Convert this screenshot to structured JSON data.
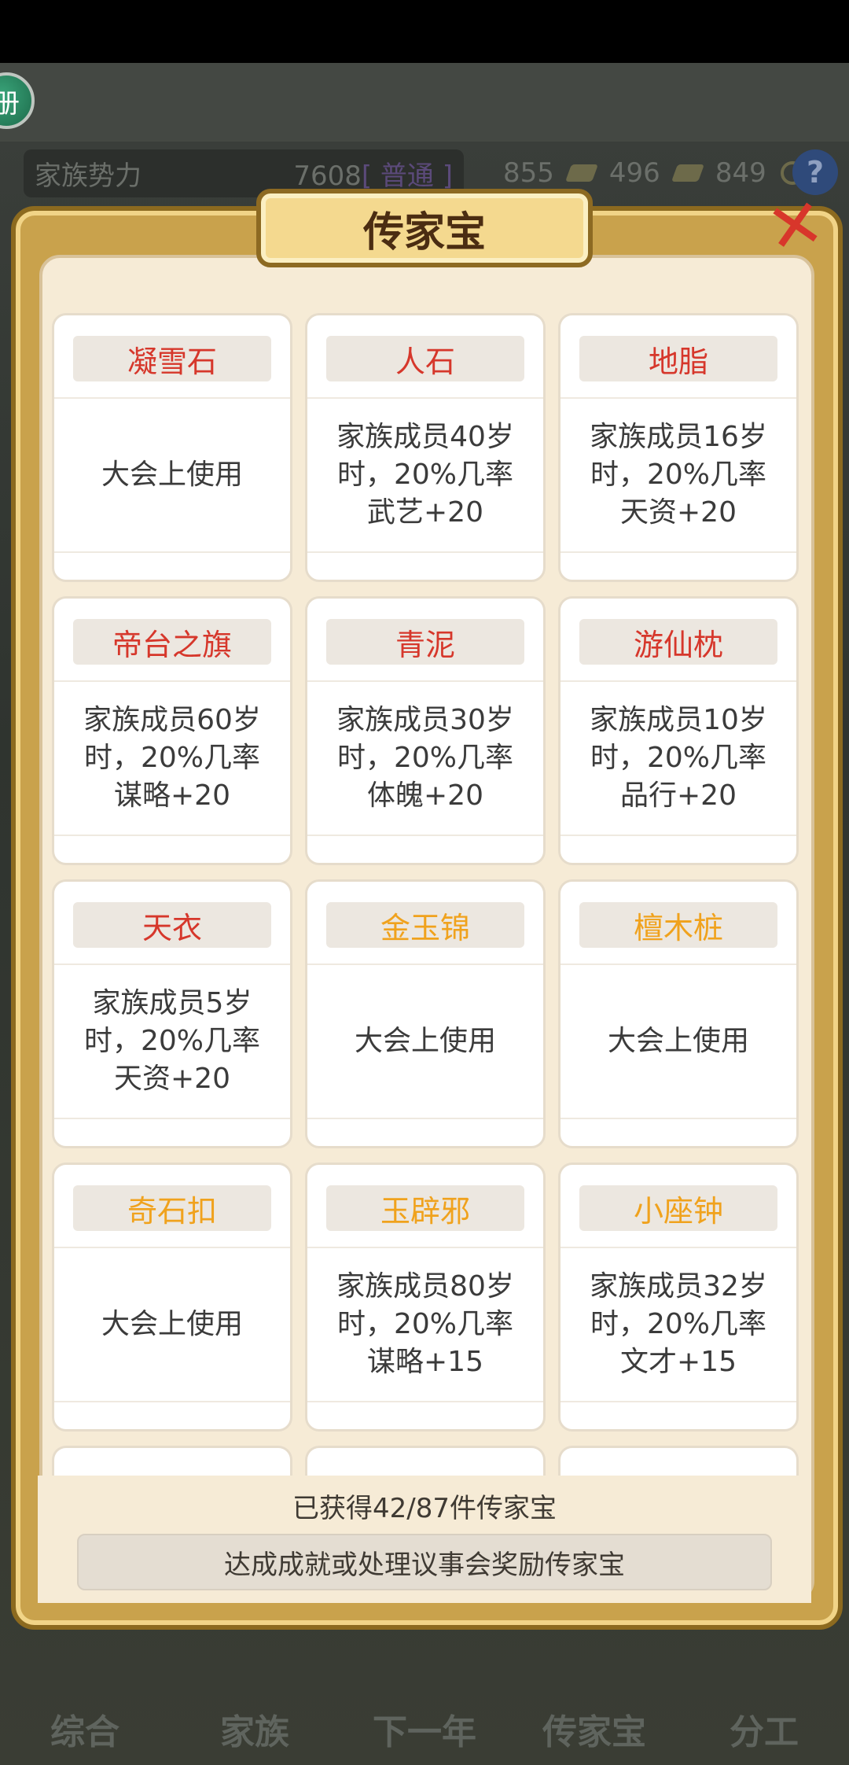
{
  "header": {
    "avatar_glyph": "册",
    "clan_label": "家族势力",
    "clan_value": "7608",
    "clan_rank": "[ 普通 ]",
    "silver": "855",
    "iron": "496",
    "coins": "849",
    "help_glyph": "?"
  },
  "modal": {
    "title": "传家宝",
    "close_glyph": "✕",
    "items": [
      {
        "name": "凝雪石",
        "color": "#d6372b",
        "desc": "大会上使用"
      },
      {
        "name": "人石",
        "color": "#d6372b",
        "desc": "家族成员40岁\n时，20%几率\n武艺+20"
      },
      {
        "name": "地脂",
        "color": "#d6372b",
        "desc": "家族成员16岁\n时，20%几率\n天资+20"
      },
      {
        "name": "帝台之旗",
        "color": "#d6372b",
        "desc": "家族成员60岁\n时，20%几率\n谋略+20"
      },
      {
        "name": "青泥",
        "color": "#d6372b",
        "desc": "家族成员30岁\n时，20%几率\n体魄+20"
      },
      {
        "name": "游仙枕",
        "color": "#d6372b",
        "desc": "家族成员10岁\n时，20%几率\n品行+20"
      },
      {
        "name": "天衣",
        "color": "#d6372b",
        "desc": "家族成员5岁\n时，20%几率\n天资+20"
      },
      {
        "name": "金玉锦",
        "color": "#f0a21d",
        "desc": "大会上使用"
      },
      {
        "name": "檀木桩",
        "color": "#f0a21d",
        "desc": "大会上使用"
      },
      {
        "name": "奇石扣",
        "color": "#f0a21d",
        "desc": "大会上使用"
      },
      {
        "name": "玉辟邪",
        "color": "#f0a21d",
        "desc": "家族成员80岁\n时，20%几率\n谋略+15"
      },
      {
        "name": "小座钟",
        "color": "#f0a21d",
        "desc": "家族成员32岁\n时，20%几率\n文才+15"
      }
    ],
    "count_text": "已获得42/87件传家宝",
    "hint_text": "达成成就或处理议事会奖励传家宝"
  },
  "nav": {
    "items": [
      "综合",
      "家族",
      "下一年",
      "传家宝",
      "分工"
    ]
  }
}
